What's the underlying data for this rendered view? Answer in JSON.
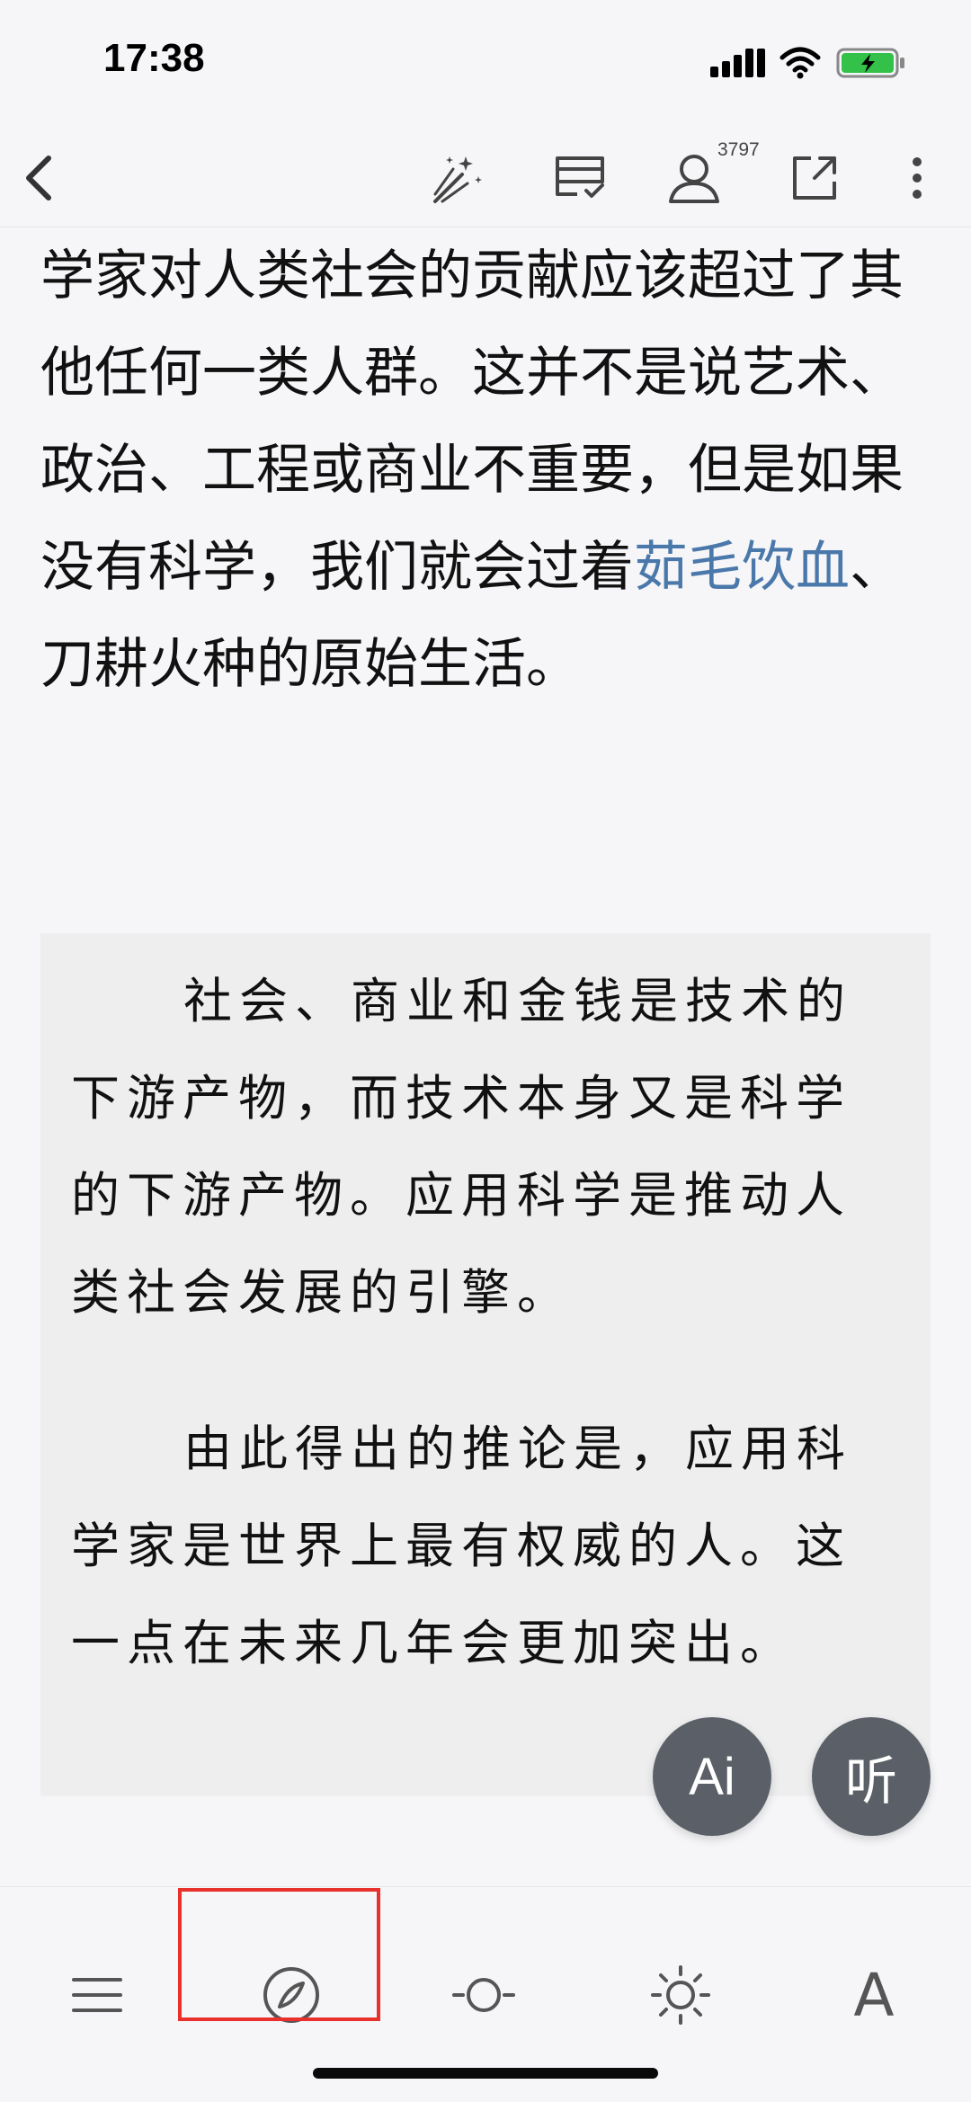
{
  "status_bar": {
    "time": "17:38",
    "icons": [
      "signal-icon",
      "wifi-icon",
      "battery-charging-icon"
    ]
  },
  "top_nav": {
    "icons": [
      "back-icon",
      "magic-wand-icon",
      "cards-icon",
      "profile-icon",
      "share-icon",
      "more-icon"
    ],
    "reader_count": "3797"
  },
  "content": {
    "paragraph_before": "学家对人类社会的贡献应该超过了其他任何一类人群。这并不是说艺术、政治、工程或商业不重要，但是如果没有科学，我们就会过着",
    "paragraph_link": "茹毛饮血",
    "paragraph_after": "、刀耕火种的原始生活。",
    "quote": [
      "社会、商业和金钱是技术的下游产物，而技术本身又是科学的下游产物。应用科学是推动人类社会发展的引擎。",
      "由此得出的推论是，应用科学家是世界上最有权威的人。这一点在未来几年会更加突出。"
    ]
  },
  "floating": {
    "ai_label": "Ai",
    "listen_label": "听"
  },
  "bottom_bar": {
    "icons": [
      "menu-icon",
      "compass-icon",
      "progress-icon",
      "brightness-icon",
      "font-icon"
    ],
    "font_label": "A"
  },
  "colors": {
    "background": "#f6f6f8",
    "link": "#4a78aa",
    "quote_background": "#eeeeef",
    "fab": "#5b6068",
    "highlight": "#e8312c"
  }
}
